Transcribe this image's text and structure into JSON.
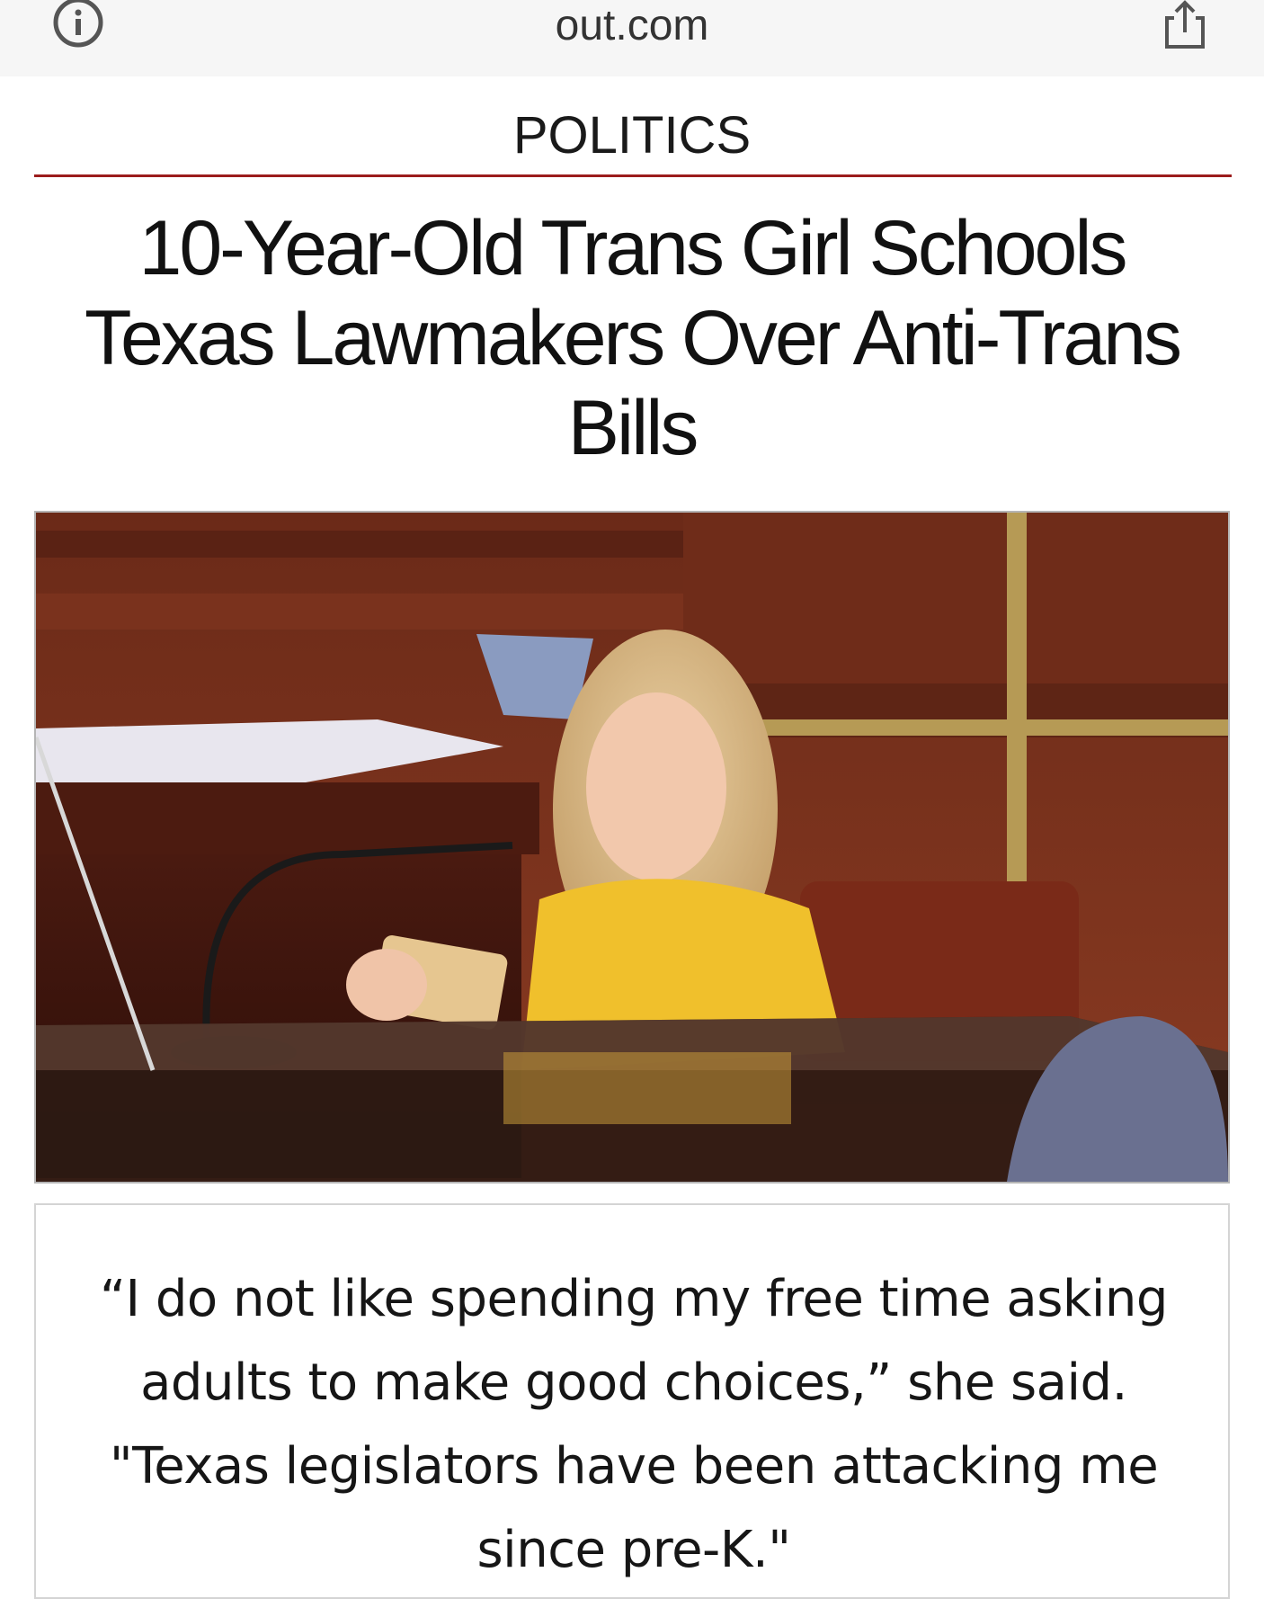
{
  "browser": {
    "url": "out.com",
    "info_icon": "info-circle-icon",
    "share_icon": "share-icon"
  },
  "article": {
    "category": "POLITICS",
    "headline": "10-Year-Old Trans Girl Schools Texas Lawmakers Over Anti-Trans Bills",
    "quote": "“I do not like spending my free time asking adults to make good choices,” she said. \"Texas legislators have been attacking me since pre-K.\""
  },
  "colors": {
    "category_rule": "#9b1c1c",
    "browser_bar": "#f6f6f6"
  }
}
